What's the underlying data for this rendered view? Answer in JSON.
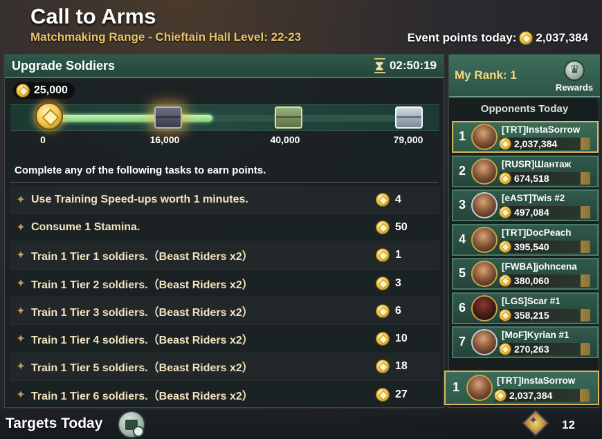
{
  "header": {
    "title": "Call to Arms",
    "subtitle": "Matchmaking Range - Chieftain Hall Level: 22-23",
    "event_points_label": "Event points today:",
    "event_points_value": "2,037,384"
  },
  "upgrade_panel": {
    "title": "Upgrade Soldiers",
    "timer": "02:50:19",
    "balance": "25,000",
    "progress": {
      "current": 25000,
      "milestones": [
        "0",
        "16,000",
        "40,000",
        "79,000"
      ]
    },
    "intro": "Complete any of the following tasks to earn points.",
    "tasks": [
      {
        "text": "Use Training Speed-ups worth 1 minutes.",
        "points": "4"
      },
      {
        "text": "Consume 1 Stamina.",
        "points": "50"
      },
      {
        "text": "Train 1 Tier 1 soldiers.（Beast Riders x2）",
        "points": "1"
      },
      {
        "text": "Train 1 Tier 2 soldiers.（Beast Riders x2）",
        "points": "3"
      },
      {
        "text": "Train 1 Tier 3 soldiers.（Beast Riders x2）",
        "points": "6"
      },
      {
        "text": "Train 1 Tier 4 soldiers.（Beast Riders x2）",
        "points": "10"
      },
      {
        "text": "Train 1 Tier 5 soldiers.（Beast Riders x2）",
        "points": "18"
      },
      {
        "text": "Train 1 Tier 6 soldiers.（Beast Riders x2）",
        "points": "27"
      }
    ]
  },
  "rank_panel": {
    "my_rank_label": "My Rank: 1",
    "rewards_label": "Rewards",
    "opponents_title": "Opponents Today",
    "opponents": [
      {
        "rank": "1",
        "name": "[TRT]InstaSorrow",
        "score": "2,037,384"
      },
      {
        "rank": "2",
        "name": "[RUSR]Шантаж",
        "score": "674,518"
      },
      {
        "rank": "3",
        "name": "[eAST]Twis #2",
        "score": "497,084"
      },
      {
        "rank": "4",
        "name": "[TRT]DocPeach",
        "score": "395,540"
      },
      {
        "rank": "5",
        "name": "[FWBA]johncena",
        "score": "380,060"
      },
      {
        "rank": "6",
        "name": "[LGS]Scar #1",
        "score": "358,215"
      },
      {
        "rank": "7",
        "name": "[MoF]Kyrian #1",
        "score": "270,263"
      }
    ],
    "my_entry": {
      "rank": "1",
      "name": "[TRT]InstaSorrow",
      "score": "2,037,384"
    }
  },
  "footer": {
    "targets_label": "Targets Today",
    "count": "12"
  },
  "colors": {
    "accent_gold": "#e8c56a",
    "panel_green": "#2f5a4c",
    "task_text": "#f4e2bf"
  }
}
